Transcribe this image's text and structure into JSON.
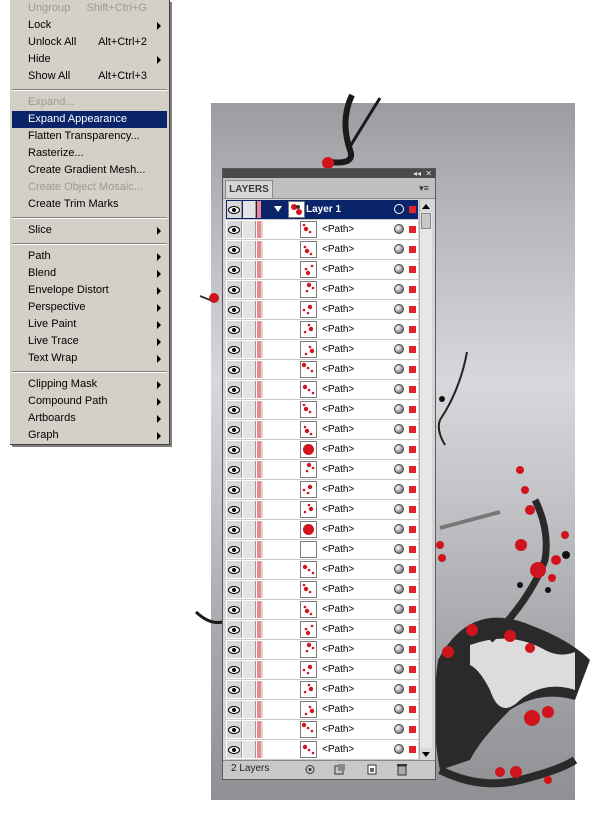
{
  "menu": {
    "items": [
      {
        "label": "Ungroup",
        "shortcut": "Shift+Ctrl+G",
        "disabled": true
      },
      {
        "label": "Lock",
        "submenu": true
      },
      {
        "label": "Unlock All",
        "shortcut": "Alt+Ctrl+2"
      },
      {
        "label": "Hide",
        "submenu": true
      },
      {
        "label": "Show All",
        "shortcut": "Alt+Ctrl+3"
      },
      {
        "label": "Expand...",
        "disabled": true
      },
      {
        "label": "Expand Appearance",
        "highlighted": true
      },
      {
        "label": "Flatten Transparency..."
      },
      {
        "label": "Rasterize..."
      },
      {
        "label": "Create Gradient Mesh..."
      },
      {
        "label": "Create Object Mosaic...",
        "disabled": true
      },
      {
        "label": "Create Trim Marks"
      },
      {
        "label": "Slice",
        "submenu": true
      },
      {
        "label": "Path",
        "submenu": true
      },
      {
        "label": "Blend",
        "submenu": true
      },
      {
        "label": "Envelope Distort",
        "submenu": true
      },
      {
        "label": "Perspective",
        "submenu": true
      },
      {
        "label": "Live Paint",
        "submenu": true
      },
      {
        "label": "Live Trace",
        "submenu": true
      },
      {
        "label": "Text Wrap",
        "submenu": true
      },
      {
        "label": "Clipping Mask",
        "submenu": true
      },
      {
        "label": "Compound Path",
        "submenu": true
      },
      {
        "label": "Artboards",
        "submenu": true
      },
      {
        "label": "Graph",
        "submenu": true
      }
    ]
  },
  "layers_panel": {
    "tab_label": "LAYERS",
    "collapse_glyph": "◂◂",
    "close_glyph": "✕",
    "menu_glyph": "▾≡",
    "layer_name": "Layer 1",
    "path_name": "<Path>",
    "path_count": 27,
    "footer_count": "2 Layers"
  },
  "colors": {
    "highlight": "#0a246a",
    "layer_color": "#e0242c",
    "blossom": "#d0141e"
  }
}
